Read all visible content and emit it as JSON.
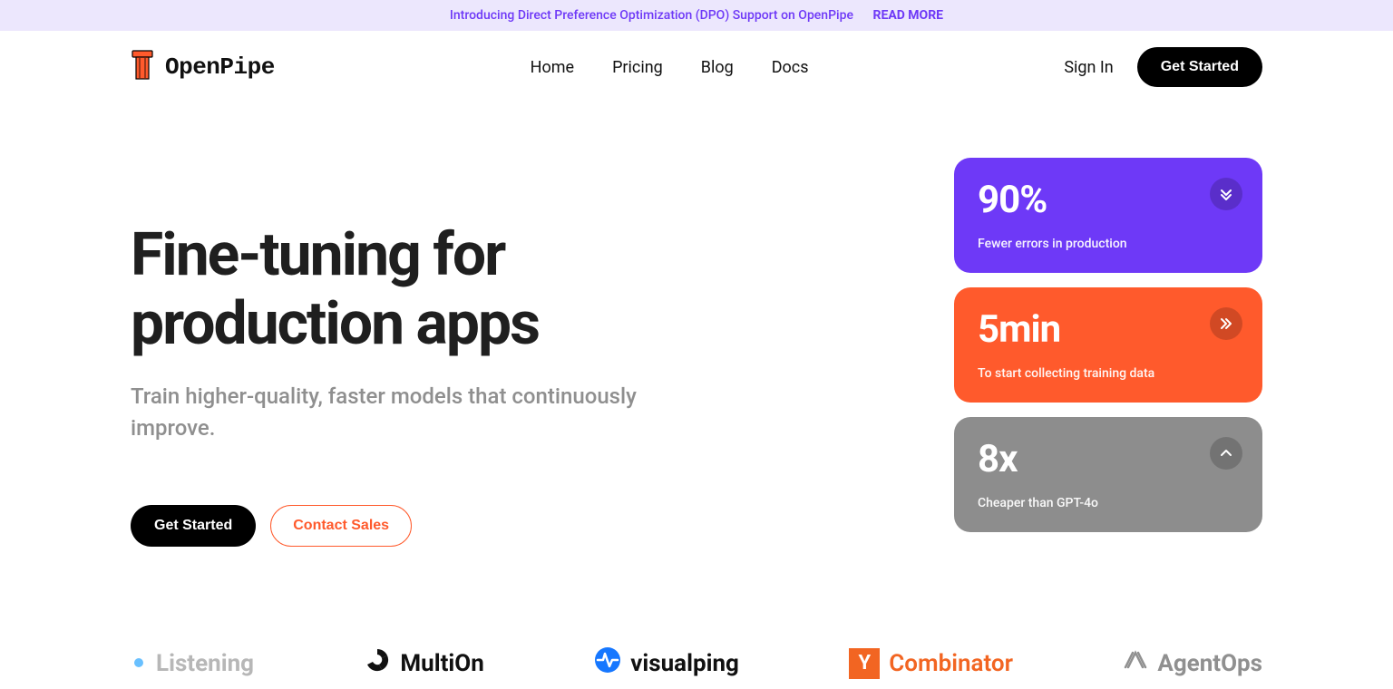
{
  "announcement": {
    "text": "Introducing Direct Preference Optimization (DPO) Support on OpenPipe",
    "cta": "READ MORE"
  },
  "brand": {
    "name": "OpenPipe"
  },
  "nav": {
    "links": [
      "Home",
      "Pricing",
      "Blog",
      "Docs"
    ],
    "signin": "Sign In",
    "get_started": "Get Started"
  },
  "hero": {
    "title_line1": "Fine-tuning for",
    "title_line2": "production apps",
    "subtitle": "Train higher-quality, faster models that continuously improve.",
    "primary_cta": "Get Started",
    "secondary_cta": "Contact Sales"
  },
  "cards": [
    {
      "metric": "90%",
      "caption": "Fewer errors in production",
      "icon": "chevrons-down-icon",
      "color": "purple"
    },
    {
      "metric": "5min",
      "caption": "To start collecting training data",
      "icon": "chevrons-right-icon",
      "color": "orange"
    },
    {
      "metric": "8x",
      "caption": "Cheaper than GPT-4o",
      "icon": "chevron-up-icon",
      "color": "gray"
    }
  ],
  "logos": [
    {
      "name": "Listening",
      "icon": "dot-icon",
      "label": "Listening"
    },
    {
      "name": "MultiOn",
      "icon": "triple-arc-icon",
      "label": "MultiOn"
    },
    {
      "name": "visualping",
      "icon": "pulse-icon",
      "label": "visualping"
    },
    {
      "name": "Combinator",
      "icon": "yc-icon",
      "label": "Combinator"
    },
    {
      "name": "AgentOps",
      "icon": "weave-icon",
      "label": "AgentOps"
    }
  ]
}
